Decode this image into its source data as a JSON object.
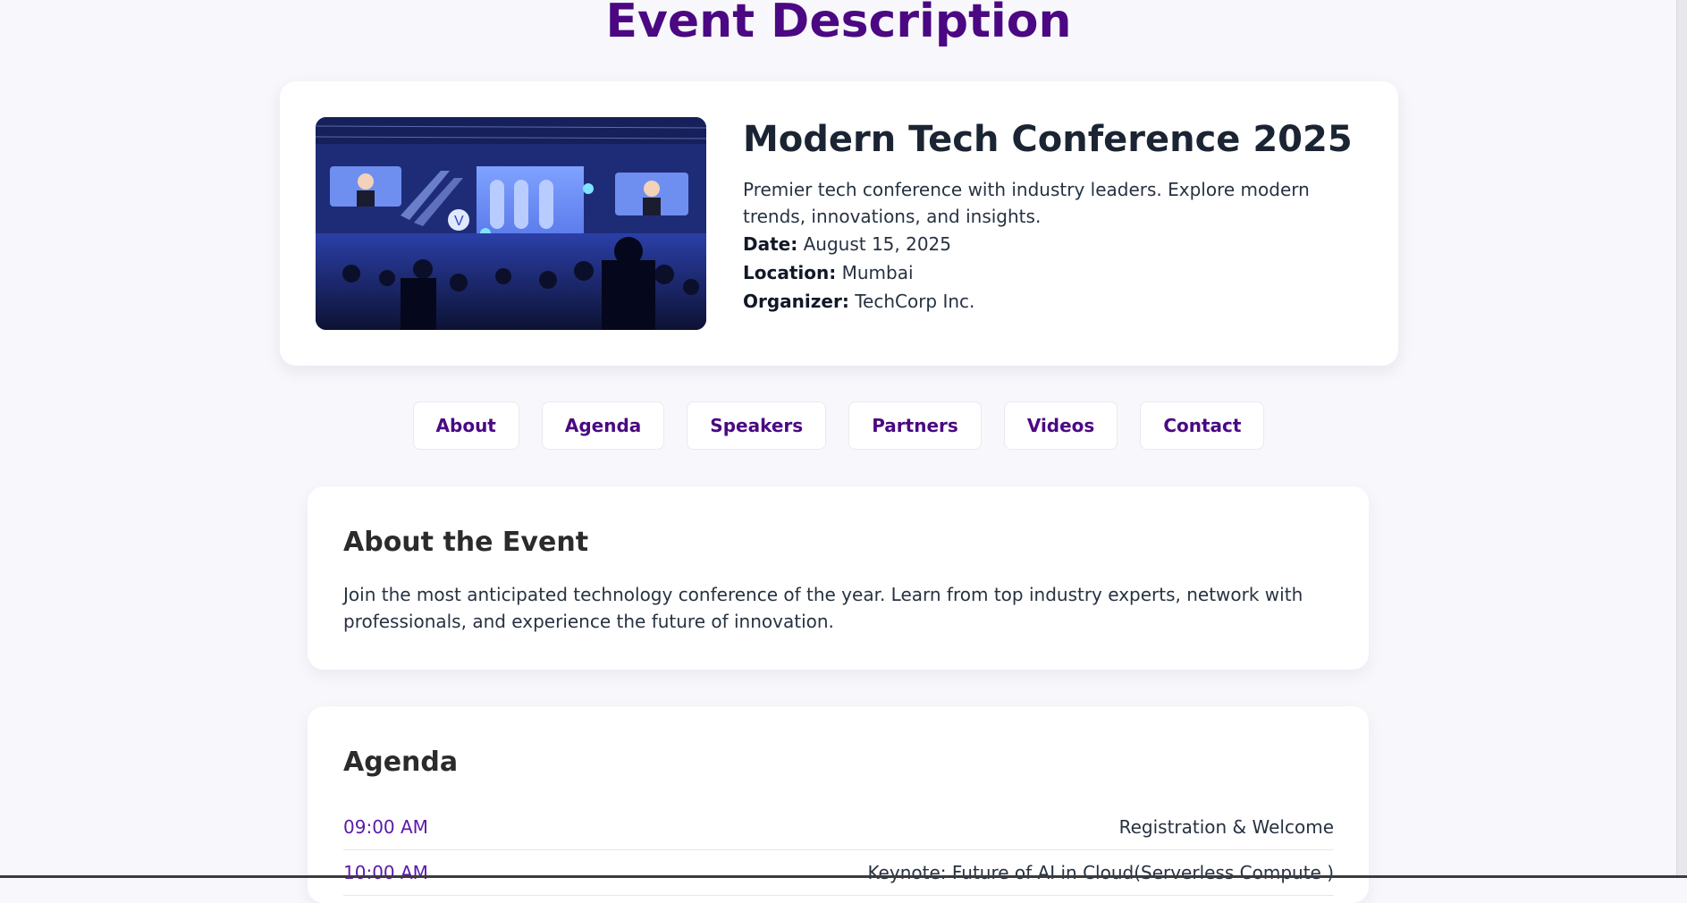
{
  "header": {
    "title": "Event Description"
  },
  "event": {
    "image_alt": "conference-stage-photo",
    "name": "Modern Tech Conference 2025",
    "summary": "Premier tech conference with industry leaders. Explore modern trends, innovations, and insights.",
    "date_label": "Date:",
    "date_value": "August 15, 2025",
    "location_label": "Location:",
    "location_value": "Mumbai",
    "organizer_label": "Organizer:",
    "organizer_value": "TechCorp Inc."
  },
  "tabs": [
    {
      "label": "About"
    },
    {
      "label": "Agenda"
    },
    {
      "label": "Speakers"
    },
    {
      "label": "Partners"
    },
    {
      "label": "Videos"
    },
    {
      "label": "Contact"
    }
  ],
  "about": {
    "title": "About the Event",
    "text": "Join the most anticipated technology conference of the year. Learn from top industry experts, network with professionals, and experience the future of innovation."
  },
  "agenda": {
    "title": "Agenda",
    "items": [
      {
        "time": "09:00 AM",
        "topic": "Registration & Welcome"
      },
      {
        "time": "10:00 AM",
        "topic": "Keynote: Future of AI in Cloud(Serverless Compute )"
      }
    ]
  },
  "colors": {
    "accent": "#4b0882",
    "time_text": "#5b1aa8",
    "background": "#f8f7fb"
  }
}
